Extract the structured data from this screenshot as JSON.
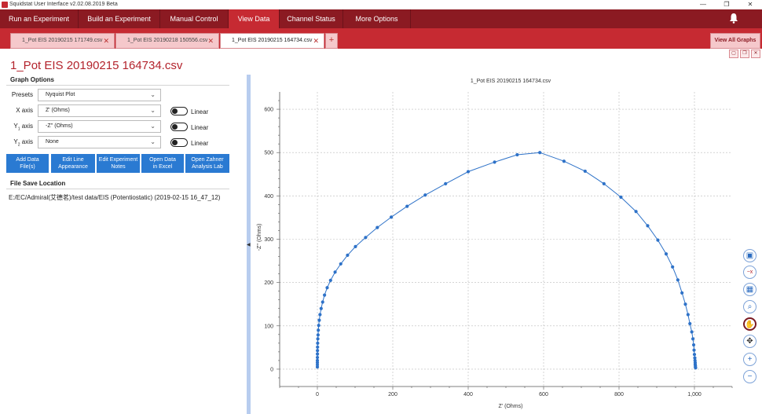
{
  "window": {
    "title": "Squidstat User Interface v2.02.08.2019 Beta",
    "min": "—",
    "restore": "❐",
    "close": "✕"
  },
  "menu": [
    {
      "label": "Run an Experiment",
      "name": "menu-run-experiment"
    },
    {
      "label": "Build an Experiment",
      "name": "menu-build-experiment"
    },
    {
      "label": "Manual Control",
      "name": "menu-manual-control"
    },
    {
      "label": "View Data",
      "name": "menu-view-data"
    },
    {
      "label": "Channel Status",
      "name": "menu-channel-status"
    },
    {
      "label": "More Options",
      "name": "menu-more-options"
    }
  ],
  "tabs": {
    "t0": "1_Pot EIS 20190215 171749.csv",
    "t1": "1_Pot EIS 20190218 150556.csv",
    "t2": "1_Pot EIS 20190215 164734.csv",
    "close": "✕",
    "add": "+",
    "view_all": "View All Graphs"
  },
  "panel_buttons": {
    "a": "▢",
    "b": "❐",
    "c": "✕"
  },
  "page_title": "1_Pot EIS 20190215 164734.csv",
  "graph_options": {
    "heading": "Graph Options",
    "presets_label": "Presets",
    "presets_value": "Nyquist Plot",
    "x_label": "X axis",
    "x_value": "Z' (Ohms)",
    "y1_label": "Y",
    "y1_sub": "1",
    "y1_suffix": " axis",
    "y1_value": "-Z'' (Ohms)",
    "y2_label": "Y",
    "y2_sub": "2",
    "y2_suffix": " axis",
    "y2_value": "None",
    "linear": "Linear",
    "chevron": "⌄"
  },
  "buttons": {
    "add_data_1": "Add Data",
    "add_data_2": "File(s)",
    "edit_line_1": "Edit Line",
    "edit_line_2": "Appearance",
    "edit_notes_1": "Edit Experiment",
    "edit_notes_2": "Notes",
    "open_excel_1": "Open Data",
    "open_excel_2": "in Excel",
    "zahner_1": "Open Zahner",
    "zahner_2": "Analysis Lab"
  },
  "file_save": {
    "heading": "File Save Location",
    "path": "E:/EC/Admiral(艾德茗)/test data/EIS (Potentiostatic) (2019-02-15 16_47_12)"
  },
  "splitter_arrow": "◀",
  "tools": {
    "image": "▣",
    "remove": "−x",
    "grid": "▦",
    "zoom": "⌕",
    "pan": "✋",
    "move": "✥",
    "zoom_in": "+",
    "zoom_out": "−"
  },
  "colors": {
    "accent": "#c62a32",
    "menu_bg": "#8b1a22",
    "button_blue": "#2a7ad2",
    "series": "#2e72c8"
  },
  "chart_data": {
    "type": "scatter",
    "title": "1_Pot EIS 20190215 164734.csv",
    "xlabel": "Z' (Ohms)",
    "ylabel": "-Z'' (Ohms)",
    "xlim": [
      -100,
      1100
    ],
    "ylim": [
      -40,
      640
    ],
    "xticks": [
      0,
      200,
      400,
      600,
      800,
      1000
    ],
    "xtick_labels": [
      "0",
      "200",
      "400",
      "600",
      "800",
      "1,000"
    ],
    "yticks": [
      0,
      100,
      200,
      300,
      400,
      500,
      600
    ],
    "ytick_labels": [
      "0",
      "100",
      "200",
      "300",
      "400",
      "500",
      "600"
    ],
    "grid": true,
    "series": [
      {
        "x": [
          0,
          0,
          0,
          0,
          0.1,
          0.2,
          0.3,
          0.5,
          0.8,
          1.2,
          1.8,
          2.5,
          3.5,
          5,
          7,
          10,
          14,
          19,
          26,
          35,
          47,
          62,
          80,
          101,
          128,
          159,
          196,
          238,
          286,
          340,
          400,
          470,
          530,
          590,
          654,
          710,
          760,
          805,
          845,
          876,
          903,
          925,
          942,
          956,
          967,
          976,
          983,
          988,
          993,
          996,
          998,
          999,
          1000,
          1001,
          1001.5,
          1002,
          1002,
          1002.5,
          1002.5,
          1003
        ],
        "y": [
          5,
          10,
          15,
          20,
          27,
          35,
          43,
          51,
          60,
          70,
          79,
          90,
          101,
          113,
          126,
          140,
          155,
          171,
          188,
          205,
          224,
          243,
          263,
          283,
          304,
          327,
          351,
          376,
          402,
          428,
          456,
          478,
          495,
          500,
          480,
          457,
          428,
          397,
          364,
          331,
          298,
          266,
          236,
          206,
          176,
          150,
          126,
          105,
          86,
          70,
          56,
          44,
          34,
          26,
          20,
          15,
          11,
          8,
          5,
          3
        ]
      }
    ]
  }
}
